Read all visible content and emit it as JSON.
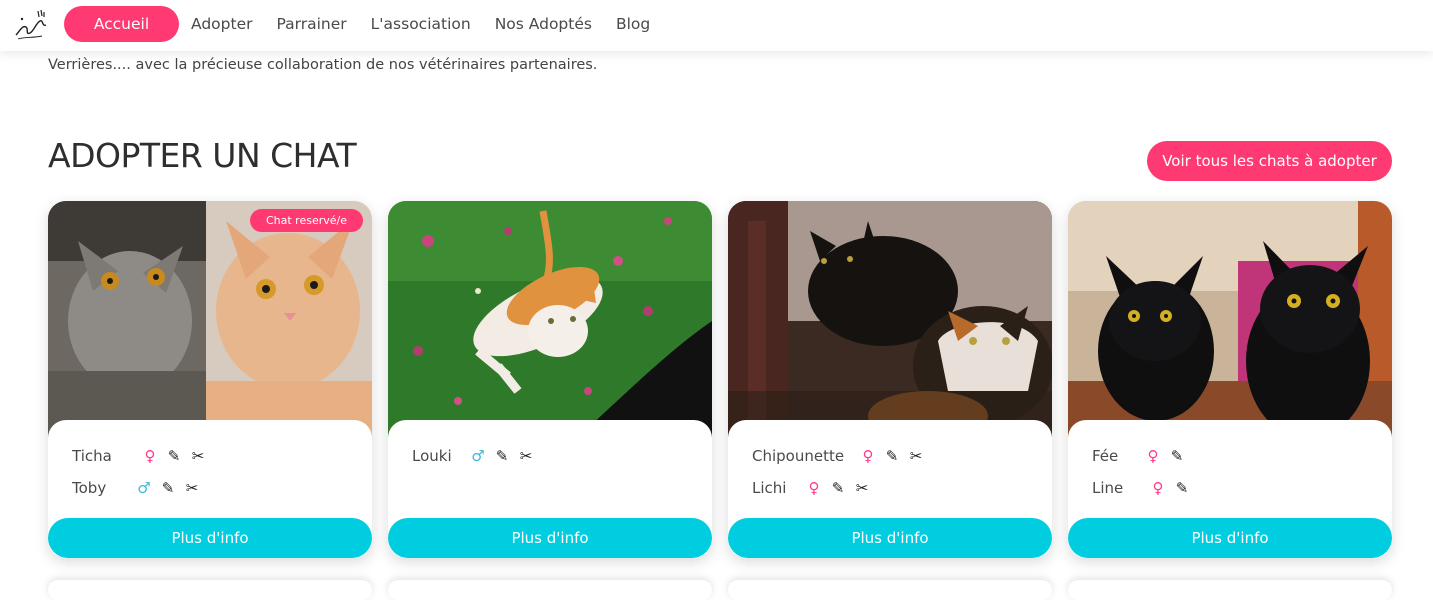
{
  "nav": {
    "items": [
      "Accueil",
      "Adopter",
      "Parrainer",
      "L'association",
      "Nos Adoptés",
      "Blog"
    ]
  },
  "intro_text": "Verrières.... avec la précieuse collaboration de nos vétérinaires partenaires.",
  "section": {
    "title": "ADOPTER UN CHAT",
    "see_all": "Voir tous les chats à adopter"
  },
  "colors": {
    "accent": "#ff3a72",
    "button": "#00cde0",
    "female": "#ff3a8c",
    "male": "#3fb8d6"
  },
  "cards": [
    {
      "badge": "Chat reservé/e",
      "cats": [
        {
          "name": "Ticha",
          "sex": "female-icon",
          "icons": [
            "vaccine-icon",
            "scissors-icon"
          ]
        },
        {
          "name": "Toby",
          "sex": "male-icon",
          "icons": [
            "vaccine-icon",
            "scissors-icon"
          ]
        }
      ],
      "button": "Plus d'info"
    },
    {
      "cats": [
        {
          "name": "Louki",
          "sex": "male-icon",
          "icons": [
            "vaccine-icon",
            "scissors-icon"
          ]
        }
      ],
      "button": "Plus d'info"
    },
    {
      "cats": [
        {
          "name": "Chipounette",
          "sex": "female-icon",
          "icons": [
            "vaccine-icon",
            "scissors-icon"
          ]
        },
        {
          "name": "Lichi",
          "sex": "female-icon",
          "icons": [
            "vaccine-icon",
            "scissors-icon"
          ]
        }
      ],
      "button": "Plus d'info"
    },
    {
      "cats": [
        {
          "name": "Fée",
          "sex": "female-icon",
          "icons": [
            "vaccine-icon"
          ]
        },
        {
          "name": "Line",
          "sex": "female-icon",
          "icons": [
            "vaccine-icon"
          ]
        }
      ],
      "button": "Plus d'info"
    }
  ]
}
